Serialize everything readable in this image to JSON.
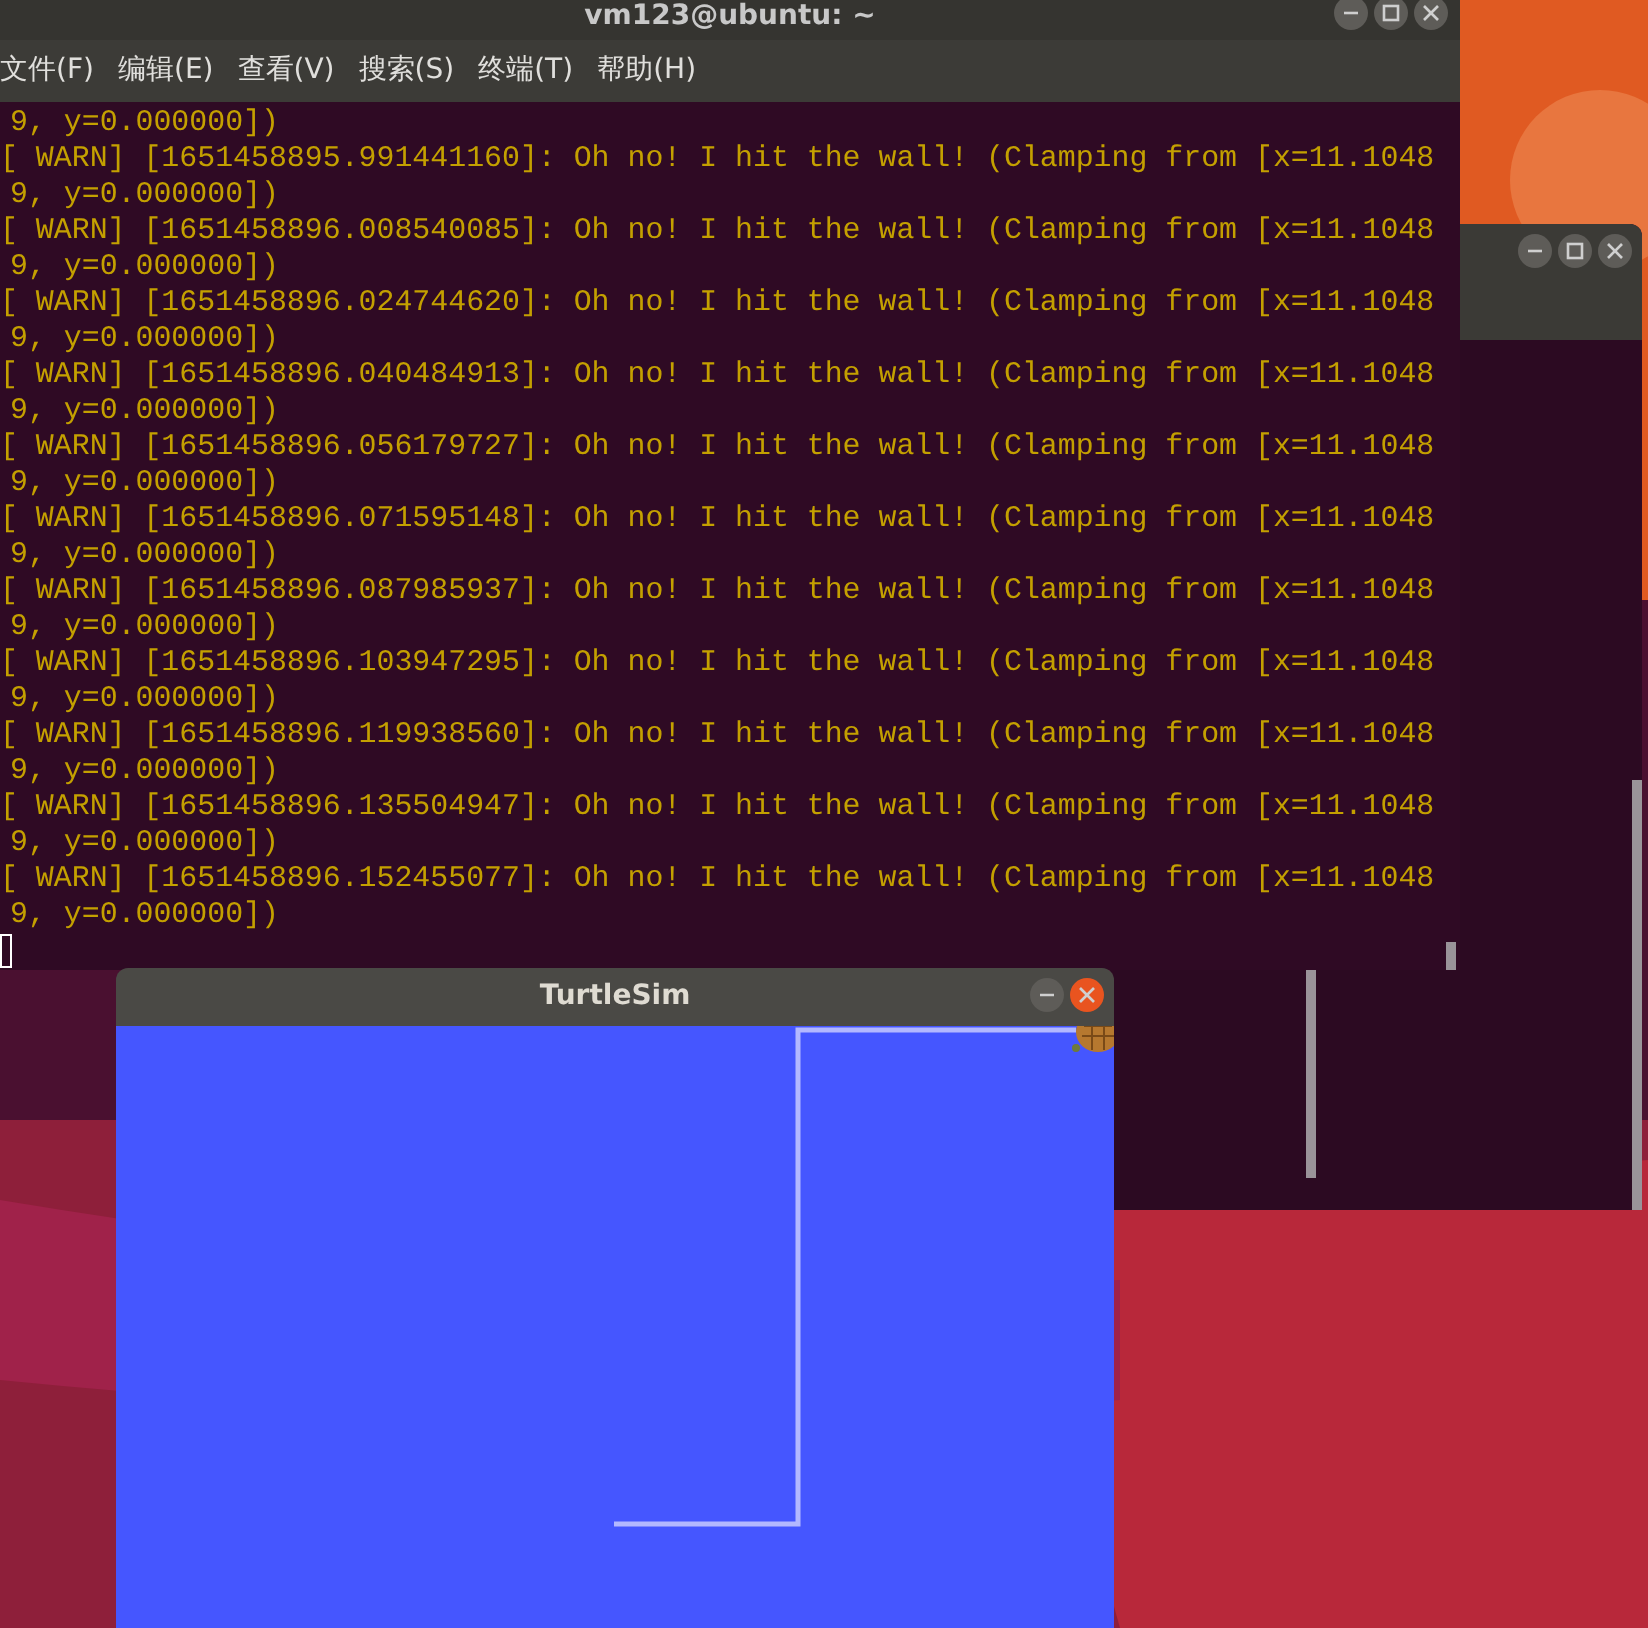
{
  "terminal": {
    "title": "vm123@ubuntu: ~",
    "menu": [
      "文件(F)",
      "编辑(E)",
      "查看(V)",
      "搜索(S)",
      "终端(T)",
      "帮助(H)"
    ],
    "lines": [
      {
        "kind": "cont",
        "text": "9, y=0.000000])"
      },
      {
        "kind": "warn",
        "text": "[ WARN] [1651458895.991441160]: Oh no! I hit the wall! (Clamping from [x=11.1048"
      },
      {
        "kind": "cont",
        "text": "9, y=0.000000])"
      },
      {
        "kind": "warn",
        "text": "[ WARN] [1651458896.008540085]: Oh no! I hit the wall! (Clamping from [x=11.1048"
      },
      {
        "kind": "cont",
        "text": "9, y=0.000000])"
      },
      {
        "kind": "warn",
        "text": "[ WARN] [1651458896.024744620]: Oh no! I hit the wall! (Clamping from [x=11.1048"
      },
      {
        "kind": "cont",
        "text": "9, y=0.000000])"
      },
      {
        "kind": "warn",
        "text": "[ WARN] [1651458896.040484913]: Oh no! I hit the wall! (Clamping from [x=11.1048"
      },
      {
        "kind": "cont",
        "text": "9, y=0.000000])"
      },
      {
        "kind": "warn",
        "text": "[ WARN] [1651458896.056179727]: Oh no! I hit the wall! (Clamping from [x=11.1048"
      },
      {
        "kind": "cont",
        "text": "9, y=0.000000])"
      },
      {
        "kind": "warn",
        "text": "[ WARN] [1651458896.071595148]: Oh no! I hit the wall! (Clamping from [x=11.1048"
      },
      {
        "kind": "cont",
        "text": "9, y=0.000000])"
      },
      {
        "kind": "warn",
        "text": "[ WARN] [1651458896.087985937]: Oh no! I hit the wall! (Clamping from [x=11.1048"
      },
      {
        "kind": "cont",
        "text": "9, y=0.000000])"
      },
      {
        "kind": "warn",
        "text": "[ WARN] [1651458896.103947295]: Oh no! I hit the wall! (Clamping from [x=11.1048"
      },
      {
        "kind": "cont",
        "text": "9, y=0.000000])"
      },
      {
        "kind": "warn",
        "text": "[ WARN] [1651458896.119938560]: Oh no! I hit the wall! (Clamping from [x=11.1048"
      },
      {
        "kind": "cont",
        "text": "9, y=0.000000])"
      },
      {
        "kind": "warn",
        "text": "[ WARN] [1651458896.135504947]: Oh no! I hit the wall! (Clamping from [x=11.1048"
      },
      {
        "kind": "cont",
        "text": "9, y=0.000000])"
      },
      {
        "kind": "warn",
        "text": "[ WARN] [1651458896.152455077]: Oh no! I hit the wall! (Clamping from [x=11.1048"
      },
      {
        "kind": "cont",
        "text": "9, y=0.000000])"
      }
    ]
  },
  "turtlesim": {
    "title": "TurtleSim"
  }
}
